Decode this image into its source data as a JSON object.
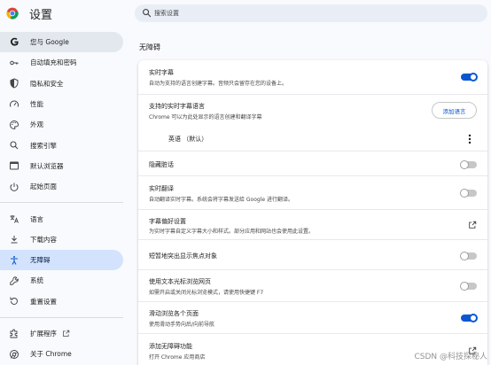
{
  "header": {
    "title": "设置",
    "search_placeholder": "搜索设置"
  },
  "sidebar": {
    "items": [
      {
        "label": "您与 Google",
        "icon": "google-g-icon"
      },
      {
        "label": "自动填充和密码",
        "icon": "key-icon"
      },
      {
        "label": "隐私和安全",
        "icon": "shield-icon"
      },
      {
        "label": "性能",
        "icon": "speedometer-icon"
      },
      {
        "label": "外观",
        "icon": "palette-icon"
      },
      {
        "label": "搜索引擎",
        "icon": "search-icon"
      },
      {
        "label": "默认浏览器",
        "icon": "browser-window-icon"
      },
      {
        "label": "起始页面",
        "icon": "power-icon"
      },
      {
        "label": "语言",
        "icon": "translate-icon"
      },
      {
        "label": "下载内容",
        "icon": "download-icon"
      },
      {
        "label": "无障碍",
        "icon": "accessibility-icon"
      },
      {
        "label": "系统",
        "icon": "wrench-icon"
      },
      {
        "label": "重置设置",
        "icon": "reset-icon"
      },
      {
        "label": "扩展程序",
        "icon": "puzzle-icon"
      },
      {
        "label": "关于 Chrome",
        "icon": "chrome-icon"
      }
    ]
  },
  "main": {
    "section_title": "无障碍",
    "rows": [
      {
        "title": "实时字幕",
        "desc": "自动为支持的语言创建字幕。音频只会留存在您的设备上。",
        "control": "toggle",
        "on": true
      },
      {
        "title": "支持的实时字幕语言",
        "desc": "Chrome 可以为此处显示的语言创建和翻译字幕",
        "control": "button",
        "button_label": "添加语言"
      },
      {
        "title": "英语 （默认）",
        "control": "more"
      },
      {
        "title": "隐藏脏话",
        "control": "toggle",
        "on": false
      },
      {
        "title": "实时翻译",
        "desc": "自动翻译实时字幕。系统会将字幕发送给 Google 进行翻译。",
        "control": "toggle",
        "on": false
      },
      {
        "title": "字幕偏好设置",
        "desc": "为实时字幕自定义字幕大小和样式。部分应用和网站也会使用此设置。",
        "control": "external-link"
      },
      {
        "title": "短暂地突出显示焦点对象",
        "control": "toggle",
        "on": false
      },
      {
        "title": "使用文本光标浏览网页",
        "desc": "如需开启或关闭光标浏览模式，请使用快捷键 F7",
        "control": "toggle",
        "on": false
      },
      {
        "title": "滑动浏览各个页面",
        "desc": "使用滑动手势向后/向前导航",
        "control": "toggle",
        "on": true
      },
      {
        "title": "添加无障碍功能",
        "desc": "打开 Chrome 应用商店",
        "control": "external-link"
      }
    ]
  },
  "watermark": "CSDN @科技探秘人",
  "colors": {
    "accent": "#0b57d0",
    "active_bg": "#d3e3fd",
    "page_bg": "#f8fafd"
  }
}
